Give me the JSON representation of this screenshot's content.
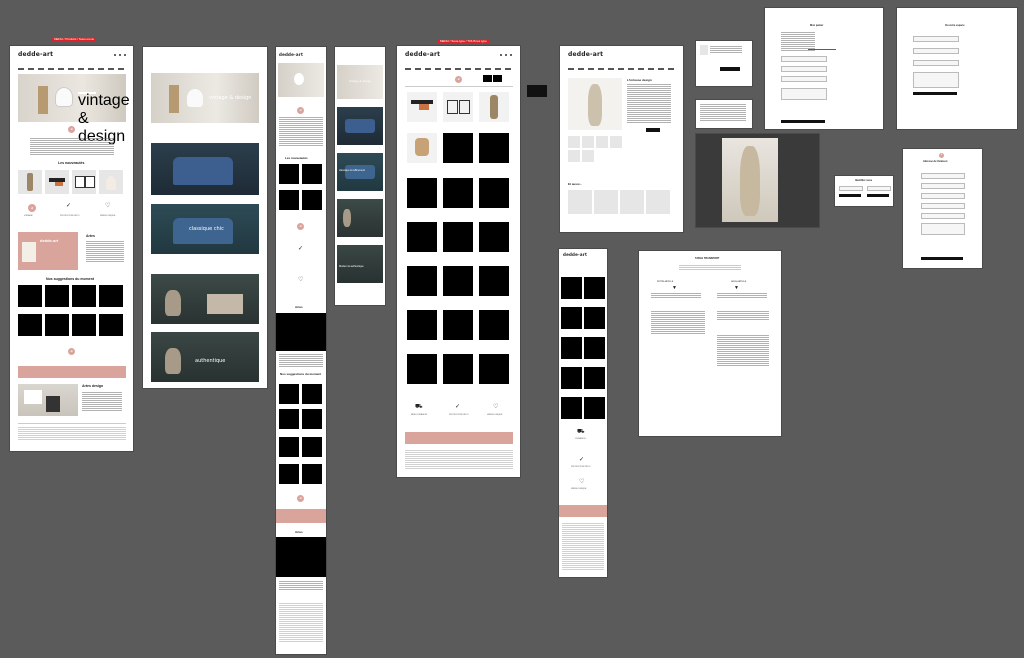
{
  "tags": {
    "home": "MENU / Produits / Sous-menu",
    "listing": "MENU / Sous-type / TOUS les type"
  },
  "brand": {
    "logo": "dedde-art",
    "monogram": "d"
  },
  "home": {
    "hero_text": "vintage & design",
    "section_new": "Les nouveautés",
    "badges": [
      "VINTAGE",
      "PROTECTION DÉCO",
      "VENDU UNIQUE"
    ],
    "artist_title": "Artes",
    "promo_logo": "dedde-art",
    "promo_text": "Bienvenue au pays de l'Ardeche",
    "section_suggestions": "Nos suggestions du moment",
    "artist_design": "Artes design"
  },
  "slides": {
    "slide1": "vintage & design",
    "slide2": "classique chic",
    "slide3": "authentique"
  },
  "mobile": {
    "section_new": "Les nouveautés",
    "artist": "Artes",
    "suggestions": "Nos suggestions du moment",
    "artist2": "Artes"
  },
  "slides_mobile": {
    "s1": "vintage & design",
    "s2": "classique & raffinement",
    "s3": "Modern & authentique"
  },
  "listing": {
    "footer_badges": [
      "MISE LIVRAISON",
      "PROTECTION DÉCO",
      "VENDU UNIQUE"
    ]
  },
  "product": {
    "title": "L'lorteuse design",
    "section_also": "Et aussi..."
  },
  "mobile_listing": {
    "badges": [
      "LIVRAISON",
      "PROTECTION DÉCO",
      "VENDU UNIQUE"
    ]
  },
  "transport": {
    "title": "TABLE TRANSPORT",
    "left_col": "PETITE ARTICLE",
    "right_col": "GROS ARTICLE"
  },
  "modal": {
    "title": "Identifier vous"
  },
  "forms": {
    "cart_title": "Mon panier",
    "address_title": "Adresse de livraison",
    "account_title": "Ou votre espace"
  }
}
